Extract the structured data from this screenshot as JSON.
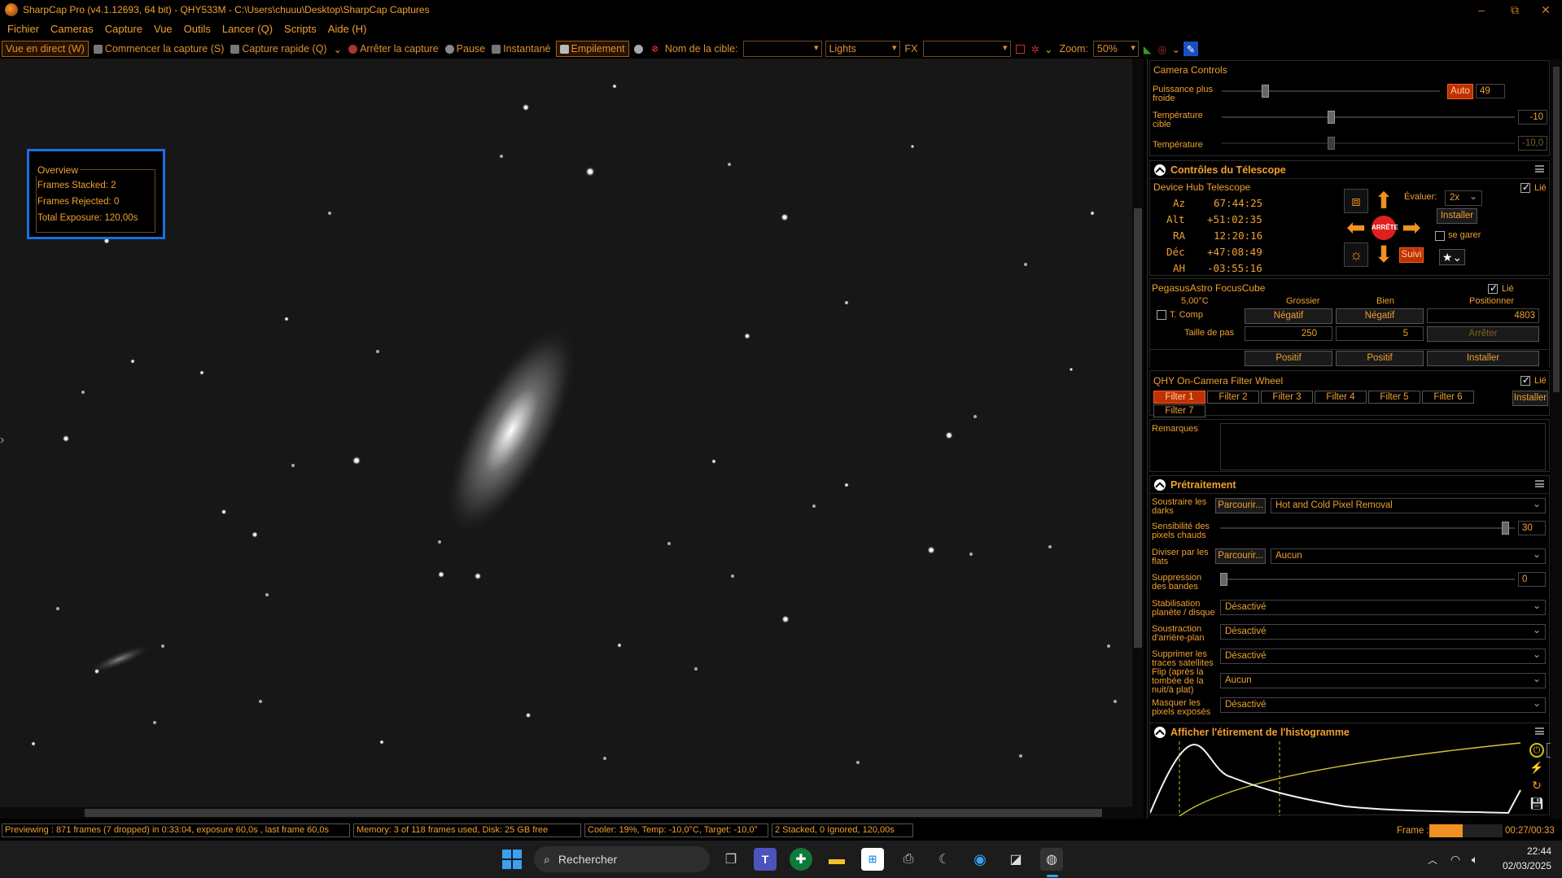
{
  "window": {
    "title": "SharpCap Pro (v4.1.12693, 64 bit) - QHY533M - C:\\Users\\chuuu\\Desktop\\SharpCap Captures",
    "minimize": "–",
    "maximize": "⧉",
    "close": "✕"
  },
  "menu": [
    "Fichier",
    "Cameras",
    "Capture",
    "Vue",
    "Outils",
    "Lancer (Q)",
    "Scripts",
    "Aide (H)"
  ],
  "toolbar": {
    "live_view": "Vue en direct (W)",
    "start_capture": "Commencer la capture (S)",
    "quick_capture": "Capture rapide (Q)",
    "stop_capture": "Arrêter la capture",
    "pause": "Pause",
    "snapshot": "Instantané",
    "stacking": "Empilement",
    "target_label": "Nom de la cible:",
    "target_value": "",
    "frame_type": "Lights",
    "fx_label": "FX",
    "fx_value": "",
    "zoom_label": "Zoom:",
    "zoom_value": "50%"
  },
  "overview": {
    "title": "Overview",
    "stacked": "Frames Stacked:  2",
    "rejected": "Frames Rejected: 0",
    "exposure": "Total Exposure:    120,00s"
  },
  "camera_controls": {
    "title": "Camera Controls",
    "cooler_power_label": "Puissance plus froide",
    "auto": "Auto",
    "cooler_power_value": "49",
    "cooler_power_level": 0.19,
    "target_temp_label": "Température cible",
    "target_temp_value": "-10",
    "target_temp_level": 0.37,
    "temp_label": "Température",
    "temp_value": "-10,0",
    "temp_level": 0.37
  },
  "telescope": {
    "title": "Contrôles du Télescope",
    "device": "Device Hub Telescope",
    "linked": "Lié",
    "az_l": "Az",
    "az": "67:44:25",
    "alt_l": "Alt",
    "alt": "+51:02:35",
    "ra_l": "RA",
    "ra": "12:20:16",
    "dec_l": "Déc",
    "dec": "+47:08:49",
    "ah_l": "AH",
    "ah": "-03:55:16",
    "rate_label": "Évaluer:",
    "rate": "2x",
    "install": "Installer",
    "park": "se garer",
    "stop": "ARRÊTE",
    "track": "Suivi"
  },
  "focuser": {
    "name": "PegasusAstro FocusCube",
    "linked": "Lié",
    "temp": "5,00°C",
    "coarse": "Grossier",
    "fine": "Bien",
    "position_label": "Positionner",
    "tcomp": "T. Comp",
    "negative": "Négatif",
    "positive": "Positif",
    "position": "4803",
    "step_label": "Taille de pas",
    "coarse_step": "250",
    "fine_step": "5",
    "stop": "Arrêter",
    "install": "Installer"
  },
  "filterwheel": {
    "name": "QHY On-Camera Filter Wheel",
    "linked": "Lié",
    "filters": [
      "Filter 1",
      "Filter 2",
      "Filter 3",
      "Filter 4",
      "Filter 5",
      "Filter 6",
      "Filter 7"
    ],
    "install": "Installer"
  },
  "remarks": {
    "label": "Remarques",
    "value": ""
  },
  "preprocessing": {
    "title": "Prétraitement",
    "dark_label": "Soustraire les darks",
    "browse": "Parcourir...",
    "dark_value": "Hot and Cold Pixel Removal",
    "hotpix_label": "Sensibilité des pixels chauds",
    "hotpix_value": "30",
    "hotpix_level": 0.98,
    "flat_label": "Diviser par les flats",
    "flat_value": "Aucun",
    "banding_label": "Suppression des bandes",
    "banding_value": "0",
    "banding_level": 0.0,
    "stab_label": "Stabilisation planète / disque",
    "stab_value": "Désactivé",
    "bg_label": "Soustraction d'arrière-plan",
    "bg_value": "Désactivé",
    "sat_label": "Supprimer les traces satellites",
    "sat_value": "Désactivé",
    "flip_label": "Flip (après la tombée de la nuit/à plat)",
    "flip_value": "Aucun",
    "mask_label": "Masquer les pixels exposés",
    "mask_value": "Désactivé"
  },
  "histogram": {
    "title": "Afficher l'étirement de l'histogramme"
  },
  "status": {
    "preview": "Previewing : 871 frames (7 dropped) in 0:33:04, exposure 60,0s , last frame 60,0s",
    "memory": "Memory: 3 of 118 frames used, Disk: 25 GB free",
    "cooler": "Cooler: 19%, Temp: -10,0°C, Target: -10,0°",
    "stack": "2 Stacked, 0 Ignored, 120,00s",
    "frame_label": "Frame :",
    "frame_progress": 0.45,
    "frame_time": "00:27/00:33"
  },
  "taskbar": {
    "search": "Rechercher",
    "time": "22:44",
    "date": "02/03/2025"
  }
}
